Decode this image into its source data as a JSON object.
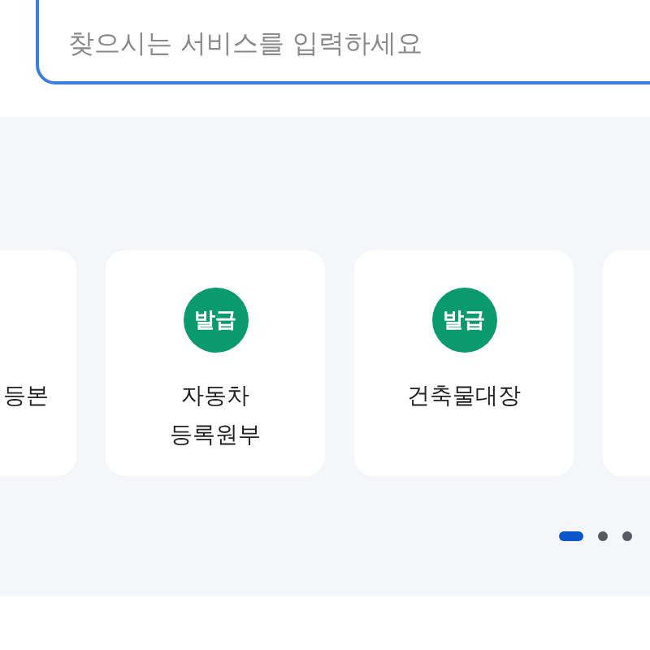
{
  "search": {
    "placeholder": "찾으시는 서비스를 입력하세요"
  },
  "cards": [
    {
      "kind": "cut-left",
      "lines": [
        "등본"
      ]
    },
    {
      "kind": "service",
      "badge": "발급",
      "lines": [
        "자동차",
        "등록원부"
      ]
    },
    {
      "kind": "service",
      "badge": "발급",
      "lines": [
        "건축물대장"
      ]
    },
    {
      "kind": "blank"
    }
  ],
  "pager": [
    {
      "selected": true
    },
    {
      "selected": false
    },
    {
      "selected": false
    }
  ]
}
